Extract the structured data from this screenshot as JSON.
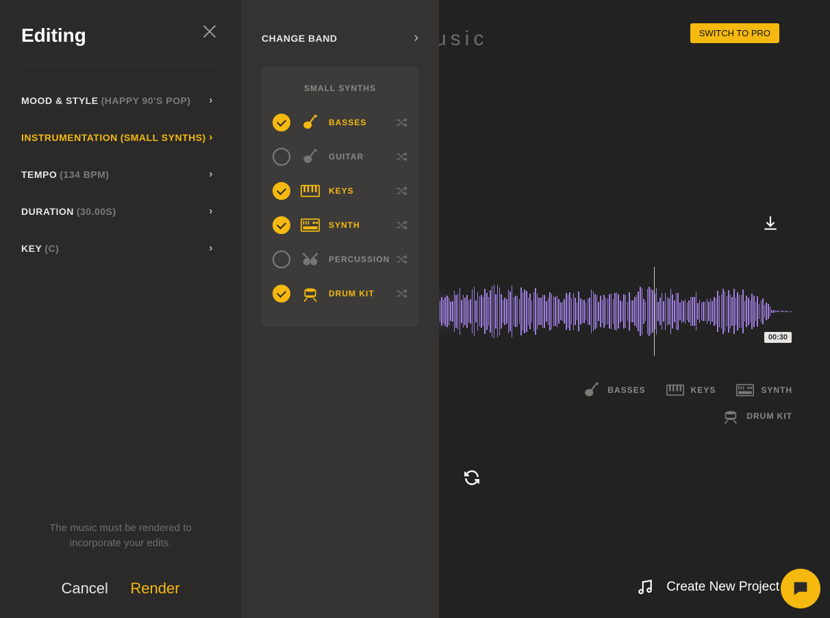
{
  "header": {
    "brand_fragment": "usic",
    "switch_label": "SWITCH TO PRO"
  },
  "edit_panel": {
    "title": "Editing",
    "items": [
      {
        "label": "MOOD & STYLE",
        "value": "(HAPPY 90'S POP)",
        "active": false
      },
      {
        "label": "INSTRUMENTATION",
        "value": "(SMALL SYNTHS)",
        "active": true
      },
      {
        "label": "TEMPO",
        "value": "(134 BPM)",
        "active": false
      },
      {
        "label": "DURATION",
        "value": "(30.00S)",
        "active": false
      },
      {
        "label": "KEY",
        "value": "(C)",
        "active": false
      }
    ],
    "note": "The music must be rendered to incorporate your edits.",
    "cancel": "Cancel",
    "render": "Render"
  },
  "band_panel": {
    "header": "CHANGE BAND",
    "card_title": "SMALL SYNTHS",
    "instruments": [
      {
        "name": "BASSES",
        "icon": "guitar",
        "on": true
      },
      {
        "name": "GUITAR",
        "icon": "guitar",
        "on": false
      },
      {
        "name": "KEYS",
        "icon": "keys",
        "on": true
      },
      {
        "name": "SYNTH",
        "icon": "synth",
        "on": true
      },
      {
        "name": "PERCUSSION",
        "icon": "percussion",
        "on": false
      },
      {
        "name": "DRUM KIT",
        "icon": "drumkit",
        "on": true
      }
    ]
  },
  "waveform": {
    "time_label": "00:30",
    "playhead_percent": 81.6
  },
  "summary_instruments": [
    {
      "name": "BASSES",
      "icon": "guitar"
    },
    {
      "name": "KEYS",
      "icon": "keys"
    },
    {
      "name": "SYNTH",
      "icon": "synth"
    },
    {
      "name": "DRUM KIT",
      "icon": "drumkit"
    }
  ],
  "footer": {
    "new_project": "Create New Project"
  },
  "colors": {
    "accent": "#f5b90f",
    "wave": "#9e7fe0",
    "bg_left": "#2b2a29",
    "bg_center": "#343331",
    "bg_main": "#232222"
  }
}
